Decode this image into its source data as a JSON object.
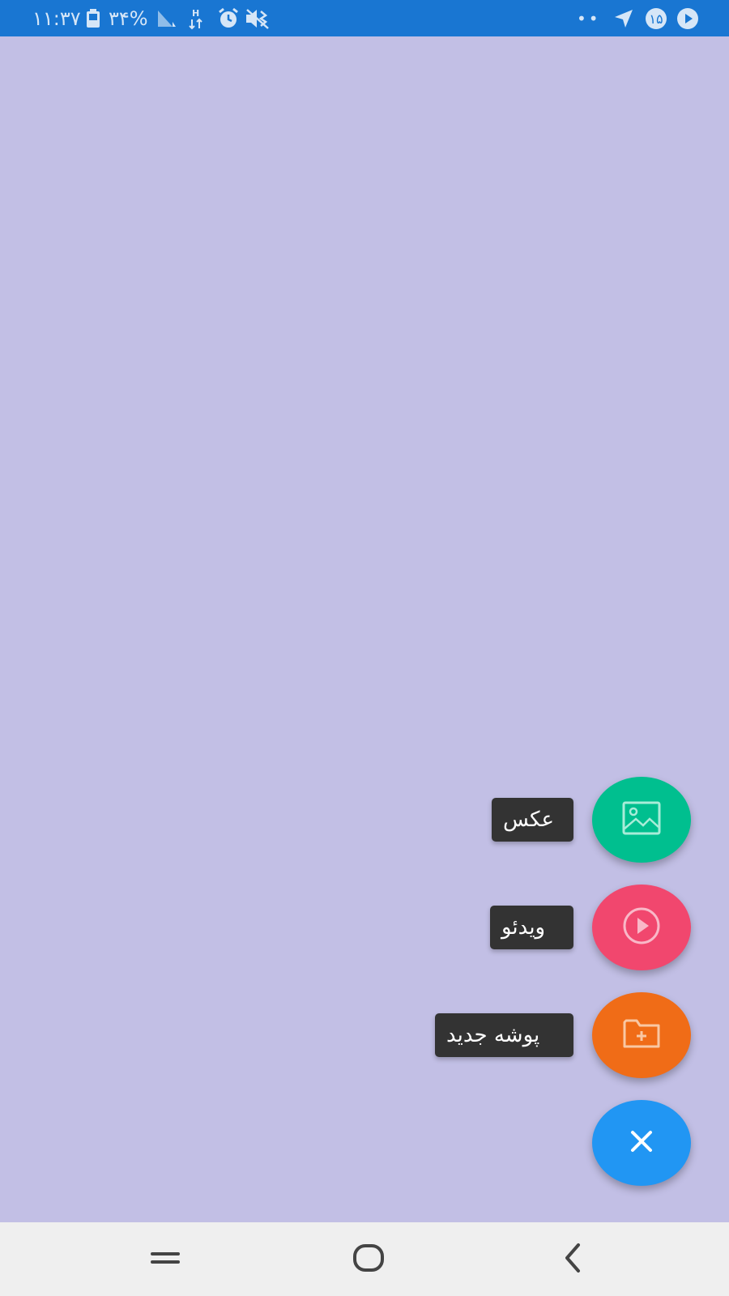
{
  "status_bar": {
    "time": "۱۱:۳۷",
    "battery_percent": "۳۴%",
    "notification_badge": "۱۵",
    "dots": "••",
    "icons": [
      "battery-icon",
      "signal-icon",
      "data-arrows-icon",
      "alarm-icon",
      "mute-icon",
      "location-arrow-icon",
      "badge-icon",
      "play-icon"
    ]
  },
  "fab_menu": {
    "items": [
      {
        "label": "عکس",
        "icon": "image-icon",
        "color": "#00bf8f"
      },
      {
        "label": "ویدئو",
        "icon": "play-circle-icon",
        "color": "#f1476e"
      },
      {
        "label": "پوشه جدید",
        "icon": "folder-add-icon",
        "color": "#f06c17"
      }
    ],
    "close_button": {
      "icon": "close-icon",
      "color": "#2196f3"
    }
  },
  "nav_bar": {
    "buttons": [
      "recents-icon",
      "home-icon",
      "back-icon"
    ]
  },
  "colors": {
    "status_bar": "#1976d2",
    "background": "#c2bfe5",
    "nav_bar": "#efefef"
  }
}
